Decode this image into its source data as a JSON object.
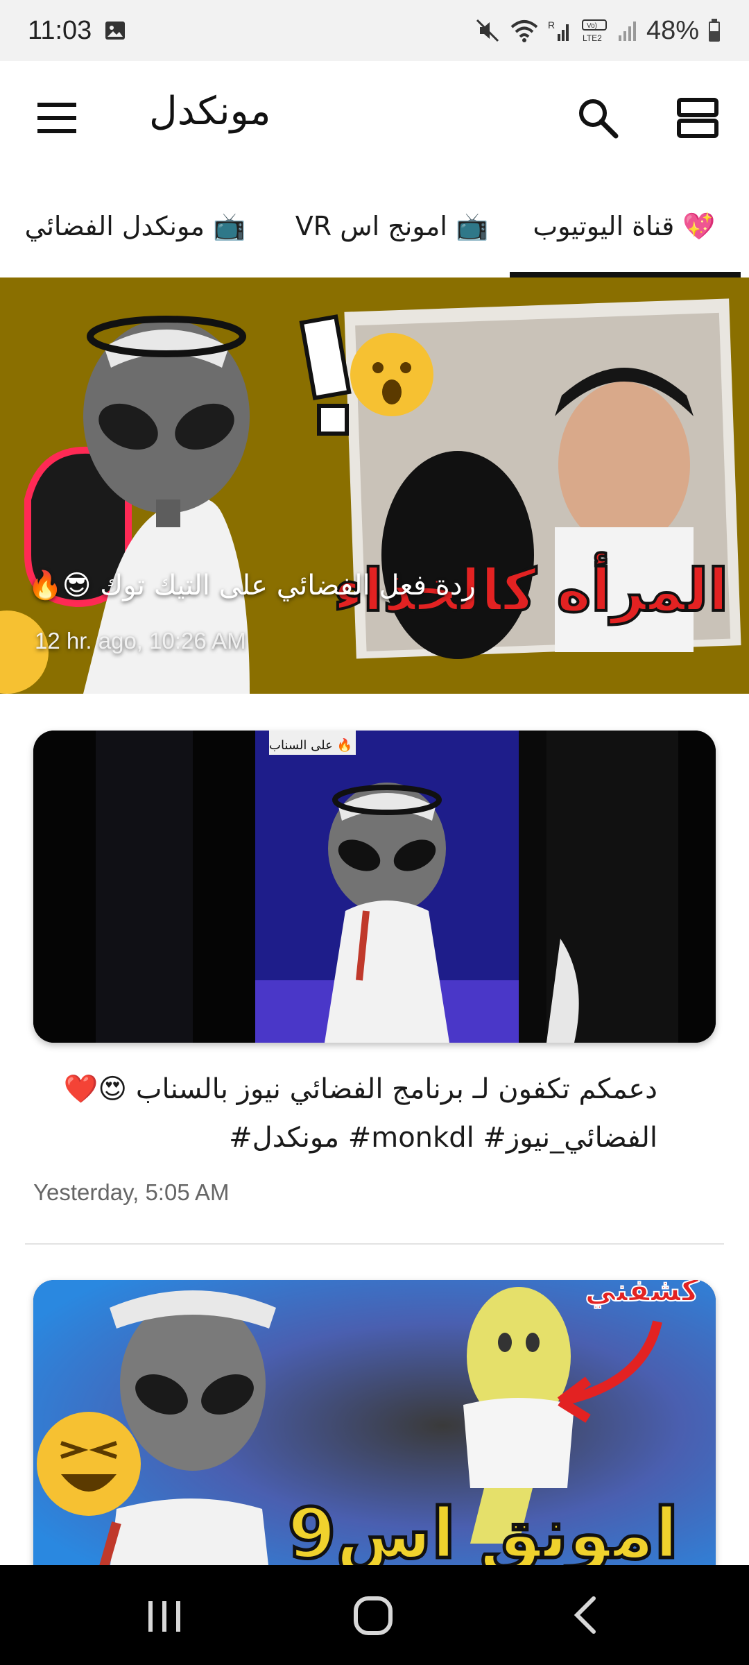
{
  "status_bar": {
    "time": "11:03",
    "battery": "48%"
  },
  "app_bar": {
    "title": "مونكدل"
  },
  "tabs": [
    {
      "label": "💖 قناة اليوتيوب",
      "selected": true
    },
    {
      "label": "📺 امونج اس VR",
      "selected": false
    },
    {
      "label": "📺 مونكدل الفضائي",
      "selected": false
    }
  ],
  "featured": {
    "title": "ردة فعل الفضائي على التيك توك 😎🔥",
    "time": "12 hr. ago, 10:26 AM",
    "thumb_text": "المرأه كالخذاء"
  },
  "posts": [
    {
      "title": "دعمكم تكفون لـ برنامج الفضائي نيوز بالسناب 😍❤️ الفضائي_نيوز# monkdl# مونكدل#",
      "time": "Yesterday, 5:05 AM",
      "thumb_text": "على السناب 🔥"
    },
    {
      "thumb_text_top": "كشفني",
      "thumb_text_big": "امونق اس9"
    }
  ],
  "colors": {
    "accent": "#111111",
    "featured_bg": "#8a7000",
    "status_bar_bg": "#f2f2f2",
    "nav_bar_bg": "#000000"
  },
  "icons": [
    "menu-icon",
    "search-icon",
    "layout-icon",
    "back-icon",
    "home-icon",
    "recents-icon"
  ]
}
